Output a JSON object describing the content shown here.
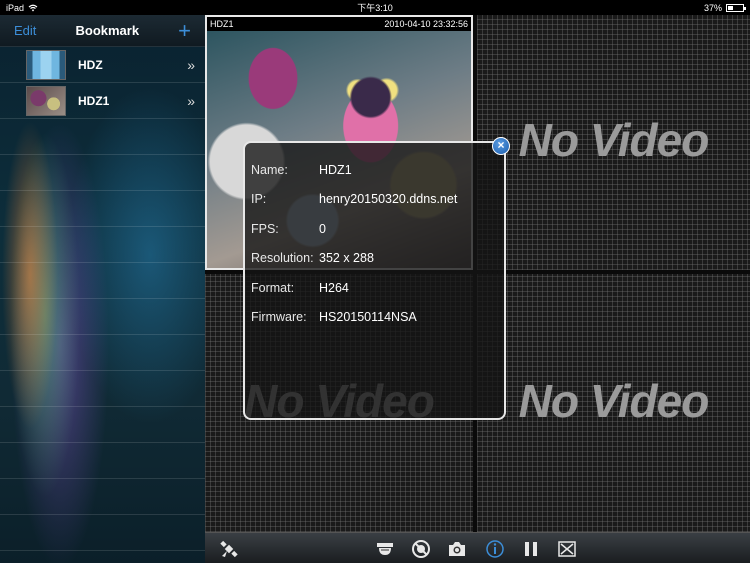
{
  "status_bar": {
    "device": "iPad",
    "time": "下午3:10",
    "battery": "37%",
    "battery_level": 0.37
  },
  "sidebar": {
    "edit_label": "Edit",
    "title": "Bookmark",
    "add_label": "+",
    "items": [
      {
        "label": "HDZ",
        "chevron": "»"
      },
      {
        "label": "HDZ1",
        "chevron": "»"
      }
    ]
  },
  "grid": {
    "camera": {
      "name": "HDZ1",
      "timestamp": "2010-04-10 23:32:56"
    },
    "no_video_text": "No Video"
  },
  "popup": {
    "close_label": "×",
    "fields": [
      {
        "key": "Name:",
        "value": "HDZ1"
      },
      {
        "key": "IP:",
        "value": "henry20150320.ddns.net"
      },
      {
        "key": "FPS:",
        "value": "0"
      },
      {
        "key": "Resolution:",
        "value": "352 x 288"
      },
      {
        "key": "Format:",
        "value": "H264"
      },
      {
        "key": "Firmware:",
        "value": "HS20150114NSA"
      }
    ]
  },
  "toolbar": {
    "icons": [
      "satellite-icon",
      "speaker-icon",
      "record-off-icon",
      "camera-icon",
      "info-icon",
      "pause-icon",
      "fullscreen-icon"
    ]
  }
}
